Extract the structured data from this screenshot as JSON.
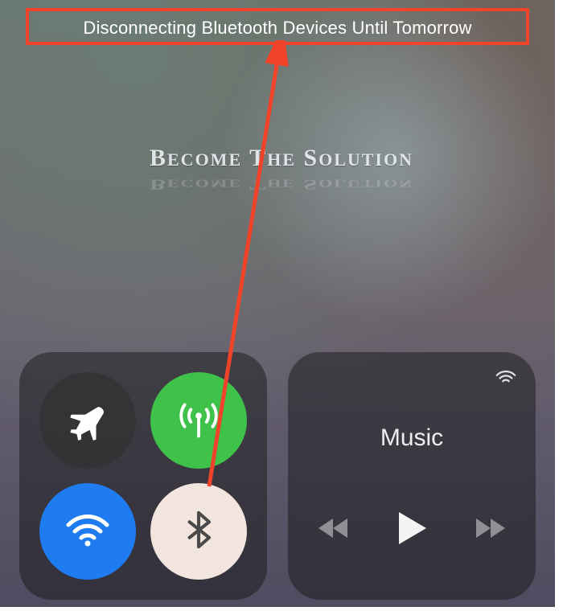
{
  "status_toast": "Disconnecting Bluetooth Devices Until Tomorrow",
  "watermark_line1_a": "B",
  "watermark_line1_b": "ECOME",
  "watermark_line1_c": " T",
  "watermark_line1_d": "HE",
  "watermark_line1_e": " S",
  "watermark_line1_f": "OLUTION",
  "music_panel": {
    "title": "Music"
  },
  "connectivity": {
    "airplane": {
      "active": false
    },
    "cellular": {
      "active": true,
      "color": "#3fc24a"
    },
    "wifi": {
      "active": true,
      "color": "#1e7cf0"
    },
    "bluetooth": {
      "active": false,
      "color": "#f2e5dd"
    }
  },
  "annotation": {
    "box_color": "#f0432a",
    "arrow_color": "#f0432a"
  }
}
